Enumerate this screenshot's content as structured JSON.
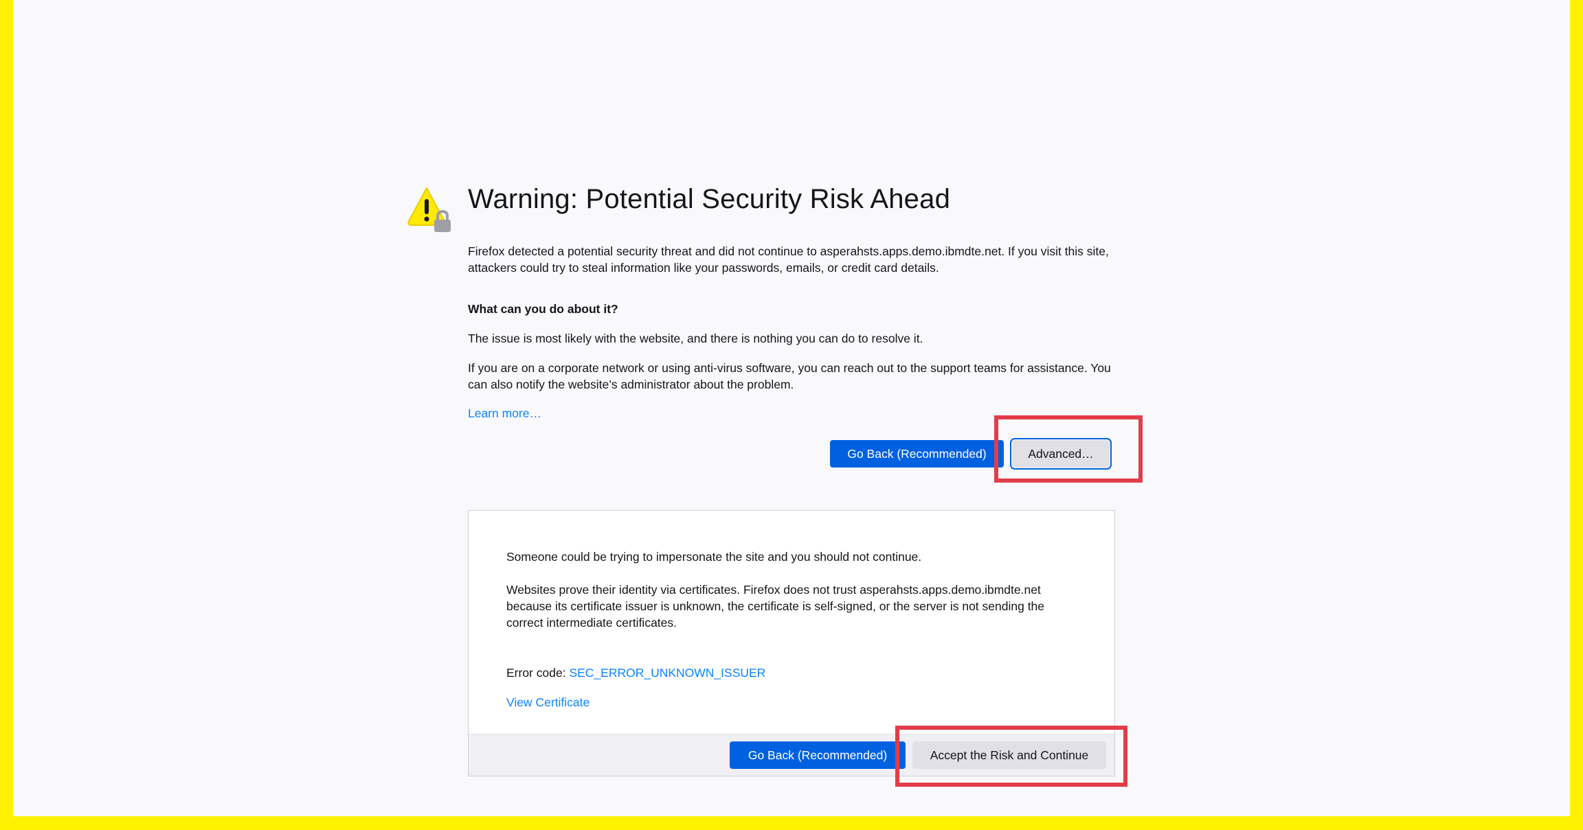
{
  "page": {
    "title": "Warning: Potential Security Risk Ahead",
    "intro": "Firefox detected a potential security threat and did not continue to asperahsts.apps.demo.ibmdte.net. If you visit this site, attackers could try to steal information like your passwords, emails, or credit card details.",
    "question": "What can you do about it?",
    "issue_text": "The issue is most likely with the website, and there is nothing you can do to resolve it.",
    "corporate_text": "If you are on a corporate network or using anti-virus software, you can reach out to the support teams for assistance. You can also notify the website’s administrator about the problem.",
    "learn_more": "Learn more…",
    "go_back_label": "Go Back (Recommended)",
    "advanced_label": "Advanced…"
  },
  "advanced_panel": {
    "impersonate_text": "Someone could be trying to impersonate the site and you should not continue.",
    "certificate_text": "Websites prove their identity via certificates. Firefox does not trust asperahsts.apps.demo.ibmdte.net because its certificate issuer is unknown, the certificate is self-signed, or the server is not sending the correct intermediate certificates.",
    "error_code_label": "Error code: ",
    "error_code": "SEC_ERROR_UNKNOWN_ISSUER",
    "view_certificate": "View Certificate",
    "go_back_label": "Go Back (Recommended)",
    "accept_label": "Accept the Risk and Continue"
  },
  "colors": {
    "frame": "#FFF200",
    "background": "#F9F9FB",
    "primary_button": "#0061E0",
    "link": "#0A84FF",
    "highlight_box": "#E23D4A",
    "warning_icon": "#FFE900"
  },
  "icons": {
    "warning": "warning-lock-icon"
  }
}
